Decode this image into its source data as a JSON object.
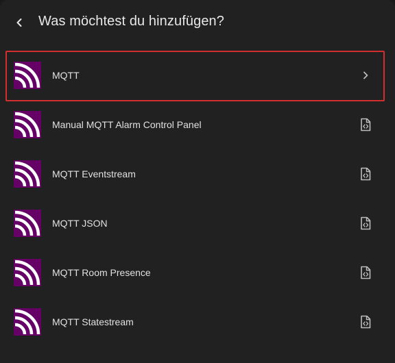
{
  "dialog": {
    "title": "Was möchtest du hinzufügen?",
    "back_icon": "chevron-left-icon"
  },
  "items": [
    {
      "label": "MQTT",
      "trailing_icon": "chevron-right-icon",
      "selected": true
    },
    {
      "label": "Manual MQTT Alarm Control Panel",
      "trailing_icon": "file-code-icon",
      "selected": false
    },
    {
      "label": "MQTT Eventstream",
      "trailing_icon": "file-code-icon",
      "selected": false
    },
    {
      "label": "MQTT JSON",
      "trailing_icon": "file-code-icon",
      "selected": false
    },
    {
      "label": "MQTT Room Presence",
      "trailing_icon": "file-code-icon",
      "selected": false
    },
    {
      "label": "MQTT Statestream",
      "trailing_icon": "file-code-icon",
      "selected": false
    }
  ],
  "colors": {
    "background": "#212121",
    "logo_bg": "#660066",
    "logo_fg": "#ffffff",
    "selection_border": "#d32f2f",
    "text": "#e1e1e1"
  }
}
